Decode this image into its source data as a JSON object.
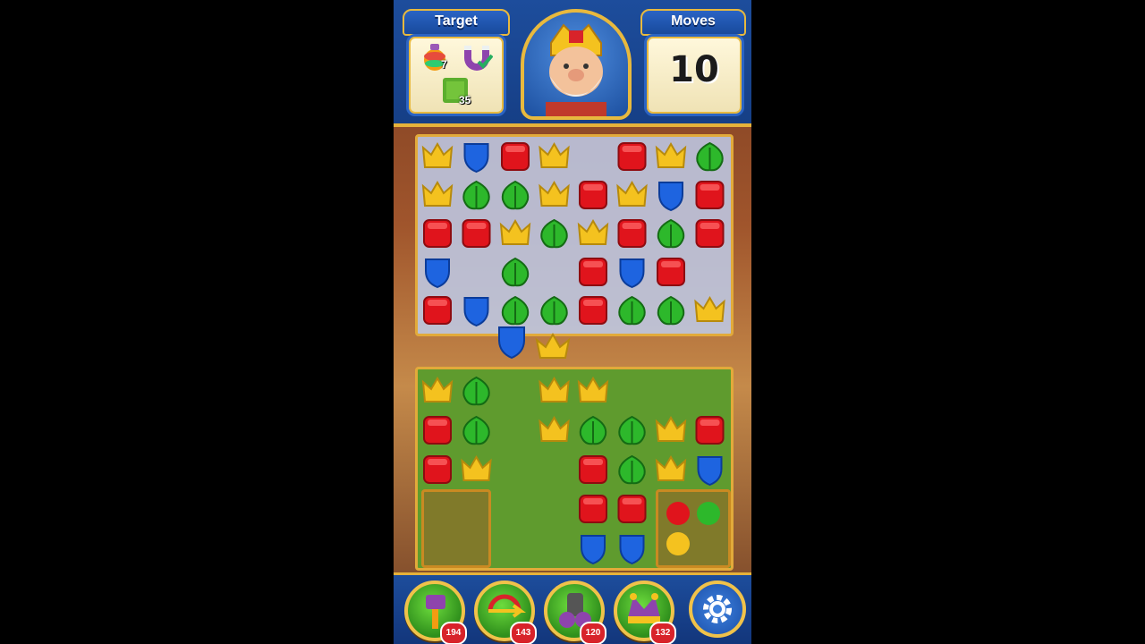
{
  "header": {
    "target_title": "Target",
    "moves_title": "Moves",
    "moves_value": "10",
    "targets": [
      {
        "icon": "rainbow-pot-icon",
        "count": "7"
      },
      {
        "icon": "magnet-icon",
        "count": "",
        "completed": true
      },
      {
        "icon": "grass-tile-icon",
        "count": "35"
      }
    ]
  },
  "boosters": [
    {
      "name": "hammer-booster",
      "icon": "hammer-icon",
      "count": "194"
    },
    {
      "name": "arrow-booster",
      "icon": "arrow-icon",
      "count": "143"
    },
    {
      "name": "cannon-booster",
      "icon": "cannon-icon",
      "count": "120"
    },
    {
      "name": "jester-hat-booster",
      "icon": "jester-hat-icon",
      "count": "132"
    }
  ],
  "settings": {
    "icon": "gear-icon"
  },
  "colors": {
    "crown": "#f4c21f",
    "shield": "#1e64e0",
    "block": "#e0141c",
    "leaf": "#2db82b",
    "accent": "#e6b23a"
  }
}
